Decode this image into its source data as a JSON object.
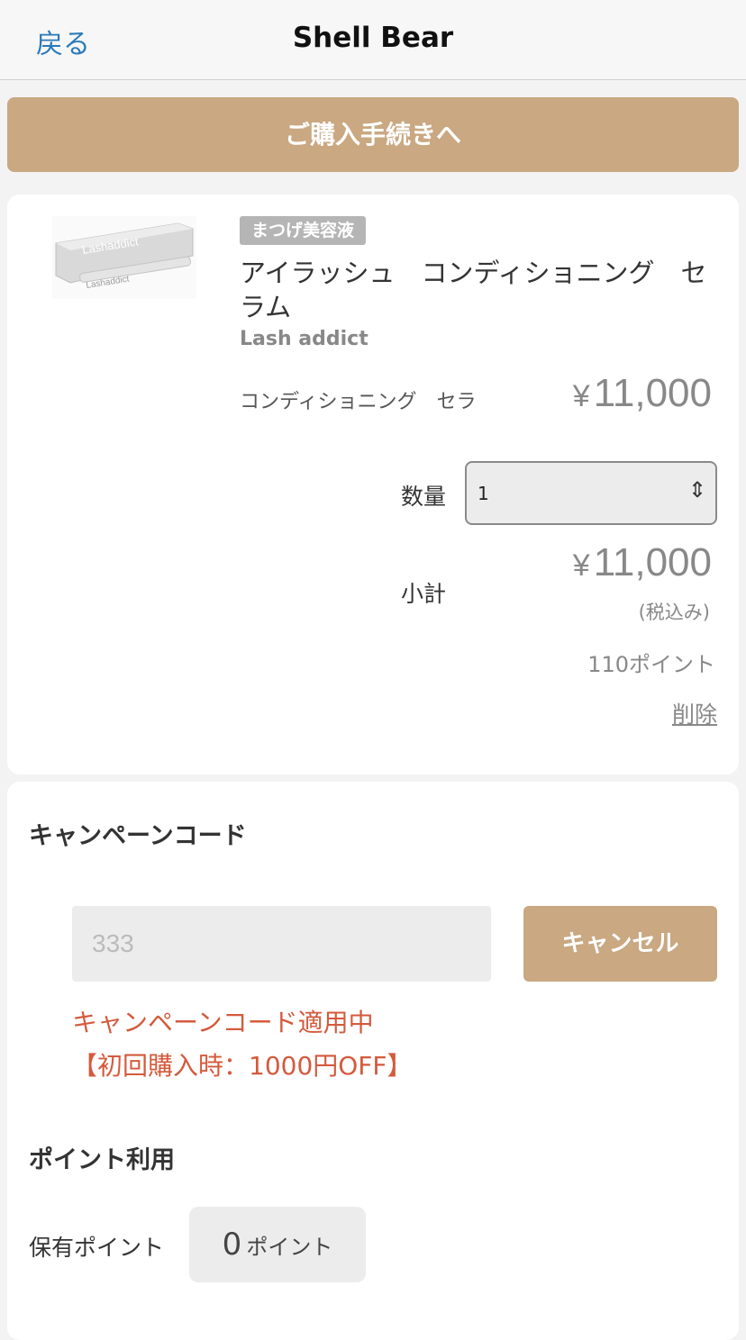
{
  "nav": {
    "back": "戻る",
    "title": "Shell Bear"
  },
  "checkout_button": "ご購入手続きへ",
  "cart_item": {
    "category": "まつげ美容液",
    "name": "アイラッシュ　コンディショニング　セラム",
    "brand": "Lash addict",
    "variant": "コンディショニング　セラ",
    "price_symbol": "¥",
    "price": "11,000",
    "quantity_label": "数量",
    "quantity_value": "1",
    "subtotal_label": "小計",
    "subtotal_symbol": "¥",
    "subtotal": "11,000",
    "tax_note": "(税込み)",
    "points_earned": "110ポイント",
    "delete": "削除"
  },
  "campaign": {
    "title": "キャンペーンコード",
    "code_value": "333",
    "cancel_button": "キャンセル",
    "applied_line1": "キャンペーンコード適用中",
    "applied_line2": "【初回購入時：1000円OFF】"
  },
  "points": {
    "title": "ポイント利用",
    "held_label": "保有ポイント",
    "held_value": "0",
    "held_unit": "ポイント"
  },
  "colors": {
    "accent": "#c9a882",
    "link": "#2a7ab8",
    "alert": "#d45a3c"
  }
}
